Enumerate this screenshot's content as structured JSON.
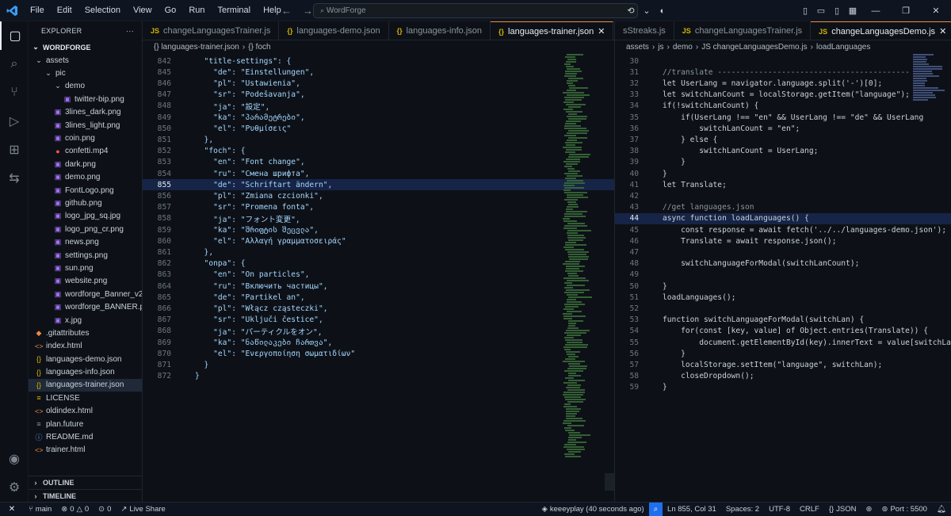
{
  "menu": [
    "File",
    "Edit",
    "Selection",
    "View",
    "Go",
    "Run",
    "Terminal",
    "Help"
  ],
  "search": {
    "placeholder": "WordForge"
  },
  "explorer": {
    "title": "EXPLORER",
    "root": "WORDFORGE",
    "tree": [
      {
        "label": "assets",
        "type": "folder",
        "depth": 0,
        "open": true
      },
      {
        "label": "pic",
        "type": "folder",
        "depth": 1,
        "open": true
      },
      {
        "label": "demo",
        "type": "folder",
        "depth": 2,
        "open": true
      },
      {
        "label": "twitter-bip.png",
        "type": "img",
        "depth": 3
      },
      {
        "label": "3lines_dark.png",
        "type": "img",
        "depth": 2
      },
      {
        "label": "3lines_light.png",
        "type": "img",
        "depth": 2
      },
      {
        "label": "coin.png",
        "type": "img",
        "depth": 2
      },
      {
        "label": "confetti.mp4",
        "type": "video",
        "depth": 2
      },
      {
        "label": "dark.png",
        "type": "img",
        "depth": 2
      },
      {
        "label": "demo.png",
        "type": "img",
        "depth": 2
      },
      {
        "label": "FontLogo.png",
        "type": "img",
        "depth": 2
      },
      {
        "label": "github.png",
        "type": "img",
        "depth": 2
      },
      {
        "label": "logo_jpg_sq.jpg",
        "type": "img",
        "depth": 2
      },
      {
        "label": "logo_png_cr.png",
        "type": "img",
        "depth": 2
      },
      {
        "label": "news.png",
        "type": "img",
        "depth": 2
      },
      {
        "label": "settings.png",
        "type": "img",
        "depth": 2
      },
      {
        "label": "sun.png",
        "type": "img",
        "depth": 2
      },
      {
        "label": "website.png",
        "type": "img",
        "depth": 2
      },
      {
        "label": "wordforge_Banner_v2.p...",
        "type": "img",
        "depth": 2
      },
      {
        "label": "wordforge_BANNER.png",
        "type": "img",
        "depth": 2
      },
      {
        "label": "x.jpg",
        "type": "img",
        "depth": 2
      },
      {
        "label": ".gitattributes",
        "type": "git",
        "depth": 0
      },
      {
        "label": "index.html",
        "type": "html",
        "depth": 0
      },
      {
        "label": "languages-demo.json",
        "type": "json",
        "depth": 0
      },
      {
        "label": "languages-info.json",
        "type": "json",
        "depth": 0
      },
      {
        "label": "languages-trainer.json",
        "type": "json",
        "depth": 0,
        "selected": true
      },
      {
        "label": "LICENSE",
        "type": "license",
        "depth": 0
      },
      {
        "label": "oldindex.html",
        "type": "html",
        "depth": 0
      },
      {
        "label": "plan.future",
        "type": "file",
        "depth": 0
      },
      {
        "label": "README.md",
        "type": "md",
        "depth": 0
      },
      {
        "label": "trainer.html",
        "type": "html",
        "depth": 0
      }
    ],
    "outline": "OUTLINE",
    "timeline": "TIMELINE"
  },
  "editor_left": {
    "tabs": [
      {
        "label": "changeLanguagesTrainer.js",
        "icon": "JS",
        "active": false
      },
      {
        "label": "languages-demo.json",
        "icon": "{}",
        "active": false
      },
      {
        "label": "languages-info.json",
        "icon": "{}",
        "active": false
      },
      {
        "label": "languages-trainer.json",
        "icon": "{}",
        "active": true
      }
    ],
    "breadcrumb": [
      "{} languages-trainer.json",
      "{} foch"
    ],
    "lines": [
      {
        "n": "842",
        "t": "  \"title-settings\": {",
        "kind": "open"
      },
      {
        "n": "845",
        "t": "    \"de\": \"Einstellungen\","
      },
      {
        "n": "846",
        "t": "    \"pl\": \"Ustawienia\","
      },
      {
        "n": "847",
        "t": "    \"sr\": \"Podešavanja\","
      },
      {
        "n": "848",
        "t": "    \"ja\": \"設定\","
      },
      {
        "n": "849",
        "t": "    \"ka\": \"პარამეტრები\","
      },
      {
        "n": "850",
        "t": "    \"el\": \"Ρυθμίσεις\""
      },
      {
        "n": "851",
        "t": "  },"
      },
      {
        "n": "852",
        "t": "  \"foch\": {",
        "kind": "open"
      },
      {
        "n": "853",
        "t": "    \"en\": \"Font change\","
      },
      {
        "n": "854",
        "t": "    \"ru\": \"Смена шрифта\","
      },
      {
        "n": "855",
        "t": "    \"de\": \"Schriftart ändern\",",
        "current": true
      },
      {
        "n": "856",
        "t": "    \"pl\": \"Zmiana czcionki\","
      },
      {
        "n": "857",
        "t": "    \"sr\": \"Promena fonta\","
      },
      {
        "n": "858",
        "t": "    \"ja\": \"フォント変更\","
      },
      {
        "n": "859",
        "t": "    \"ka\": \"შრიფტის შეცვლა\","
      },
      {
        "n": "860",
        "t": "    \"el\": \"Αλλαγή γραμματοσειράς\""
      },
      {
        "n": "861",
        "t": "  },"
      },
      {
        "n": "862",
        "t": "  \"onpa\": {",
        "kind": "open"
      },
      {
        "n": "863",
        "t": "    \"en\": \"On particles\","
      },
      {
        "n": "864",
        "t": "    \"ru\": \"Включить частицы\","
      },
      {
        "n": "865",
        "t": "    \"de\": \"Partikel an\","
      },
      {
        "n": "866",
        "t": "    \"pl\": \"Włącz cząsteczki\","
      },
      {
        "n": "867",
        "t": "    \"sr\": \"Uključi čestice\","
      },
      {
        "n": "868",
        "t": "    \"ja\": \"パーティクルをオン\","
      },
      {
        "n": "869",
        "t": "    \"ka\": \"ნაწილაკები ჩართვა\","
      },
      {
        "n": "870",
        "t": "    \"el\": \"Ενεργοποίηση σωματιδίων\""
      },
      {
        "n": "871",
        "t": "  }"
      },
      {
        "n": "872",
        "t": "}"
      }
    ]
  },
  "editor_right": {
    "tabs": [
      {
        "label": "sStreaks.js",
        "icon": "",
        "active": false
      },
      {
        "label": "changeLanguagesTrainer.js",
        "icon": "JS",
        "active": false
      },
      {
        "label": "changeLanguagesDemo.js",
        "icon": "JS",
        "active": true
      }
    ],
    "breadcrumb": [
      "assets",
      "js",
      "demo",
      "JS changeLanguagesDemo.js",
      "loadLanguages"
    ],
    "lines": [
      {
        "n": "30",
        "t": ""
      },
      {
        "n": "31",
        "t": "//translate ------------------------------------------",
        "c": true
      },
      {
        "n": "32",
        "t": "let UserLang = navigator.language.split('-')[0];"
      },
      {
        "n": "33",
        "t": "let switchLanCount = localStorage.getItem(\"language\");"
      },
      {
        "n": "34",
        "t": "if(!switchLanCount) {"
      },
      {
        "n": "35",
        "t": "    if(UserLang !== \"en\" && UserLang !== \"de\" && UserLang"
      },
      {
        "n": "36",
        "t": "        switchLanCount = \"en\";"
      },
      {
        "n": "37",
        "t": "    } else {"
      },
      {
        "n": "38",
        "t": "        switchLanCount = UserLang;"
      },
      {
        "n": "39",
        "t": "    }"
      },
      {
        "n": "40",
        "t": "}"
      },
      {
        "n": "41",
        "t": "let Translate;"
      },
      {
        "n": "42",
        "t": ""
      },
      {
        "n": "43",
        "t": "//get languages.json",
        "c": true
      },
      {
        "n": "44",
        "t": "async function loadLanguages() {",
        "current": true
      },
      {
        "n": "45",
        "t": "    const response = await fetch('../../languages-demo.json');"
      },
      {
        "n": "46",
        "t": "    Translate = await response.json();"
      },
      {
        "n": "47",
        "t": ""
      },
      {
        "n": "48",
        "t": "    switchLanguageForModal(switchLanCount);"
      },
      {
        "n": "49",
        "t": ""
      },
      {
        "n": "50",
        "t": "}"
      },
      {
        "n": "51",
        "t": "loadLanguages();"
      },
      {
        "n": "52",
        "t": ""
      },
      {
        "n": "53",
        "t": "function switchLanguageForModal(switchLan) {"
      },
      {
        "n": "54",
        "t": "    for(const [key, value] of Object.entries(Translate)) {"
      },
      {
        "n": "55",
        "t": "        document.getElementById(key).innerText = value[switchLan"
      },
      {
        "n": "56",
        "t": "    }"
      },
      {
        "n": "57",
        "t": "    localStorage.setItem(\"language\", switchLan);"
      },
      {
        "n": "58",
        "t": "    closeDropdown();"
      },
      {
        "n": "59",
        "t": "}"
      }
    ]
  },
  "status": {
    "branch": "main",
    "errors": "0",
    "warnings": "0",
    "ports": "0",
    "liveshare": "Live Share",
    "blame": "keeeyplay (40 seconds ago)",
    "position": "Ln 855, Col 31",
    "spaces": "Spaces: 2",
    "encoding": "UTF-8",
    "eol": "CRLF",
    "language": "JSON",
    "port": "Port : 5500"
  }
}
